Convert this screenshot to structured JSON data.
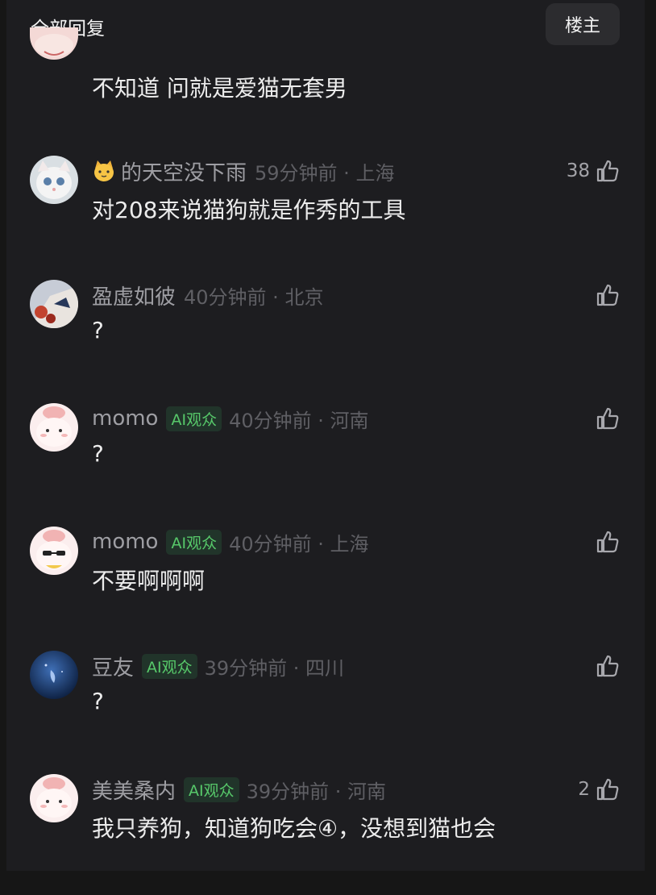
{
  "header": {
    "title": "全部回复",
    "owner_button": "楼主"
  },
  "top_comment": {
    "text": "不知道 问就是爱猫无套男"
  },
  "comments": [
    {
      "name": "的天空没下雨",
      "name_prefix_icon": "cat-face-emoji",
      "time": "59分钟前 · 上海",
      "text": "对208来说猫狗就是作秀的工具",
      "likes": "38"
    },
    {
      "name": "盈虚如彼",
      "time": "40分钟前 · 北京",
      "text": "?",
      "likes": ""
    },
    {
      "name": "momo",
      "badge": "AI观众",
      "time": "40分钟前 · 河南",
      "text": "?",
      "likes": ""
    },
    {
      "name": "momo",
      "badge": "AI观众",
      "time": "40分钟前 · 上海",
      "text": "不要啊啊啊",
      "likes": ""
    },
    {
      "name": "豆友",
      "badge": "AI观众",
      "time": "39分钟前 · 四川",
      "text": "?",
      "likes": ""
    },
    {
      "name": "美美桑内",
      "badge": "AI观众",
      "time": "39分钟前 · 河南",
      "text": "我只养狗，知道狗吃会④，没想到猫也会",
      "likes": "2"
    }
  ],
  "colors": {
    "background": "#1d1d20",
    "badge_text": "#57c96a",
    "meta_text": "#5f5f64",
    "name_text": "#9e9ea3"
  }
}
